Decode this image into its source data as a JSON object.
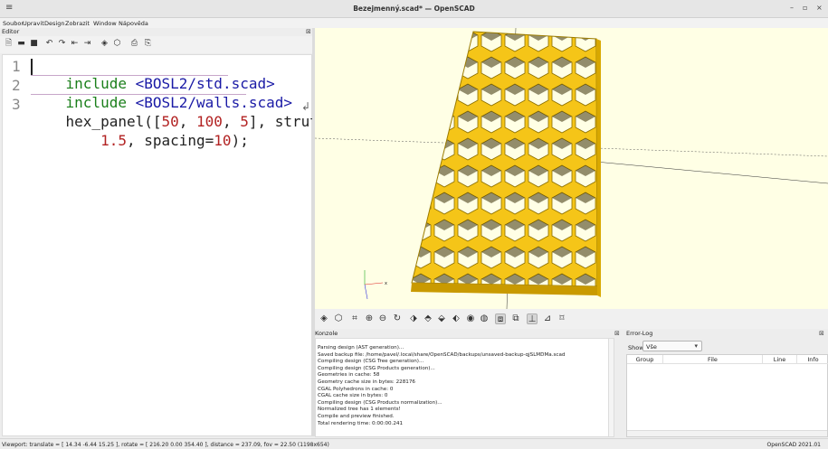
{
  "window": {
    "title": "Bezejmenný.scad* — OpenSCAD",
    "menu_icon": "≡",
    "minimize": "–",
    "maximize": "▫",
    "close": "×"
  },
  "menubar": [
    "Soubor",
    "Upravit",
    "Design",
    "Zobrazit",
    "Window",
    "Nápověda"
  ],
  "editor": {
    "title": "Editor",
    "lines": [
      {
        "n": "1",
        "tokens": [
          {
            "t": "include",
            "c": "kw"
          },
          {
            "t": " ",
            "c": "plain"
          },
          {
            "t": "<BOSL2/std.scad>",
            "c": "path"
          }
        ]
      },
      {
        "n": "2",
        "tokens": [
          {
            "t": "include",
            "c": "kw"
          },
          {
            "t": " ",
            "c": "plain"
          },
          {
            "t": "<BOSL2/walls.scad>",
            "c": "path"
          }
        ]
      },
      {
        "n": "3",
        "tokens": [
          {
            "t": "hex_panel([",
            "c": "plain"
          },
          {
            "t": "50",
            "c": "num"
          },
          {
            "t": ", ",
            "c": "plain"
          },
          {
            "t": "100",
            "c": "num"
          },
          {
            "t": ", ",
            "c": "plain"
          },
          {
            "t": "5",
            "c": "num"
          },
          {
            "t": "], strut=",
            "c": "plain"
          }
        ]
      },
      {
        "n": "",
        "tokens": [
          {
            "t": "    ",
            "c": "plain"
          },
          {
            "t": "1.5",
            "c": "num"
          },
          {
            "t": ", spacing=",
            "c": "plain"
          },
          {
            "t": "10",
            "c": "num"
          },
          {
            "t": ");",
            "c": "plain"
          }
        ]
      }
    ]
  },
  "viewport": {
    "bg": "#ffffe5",
    "model_color": "#f5c518",
    "axis_label": "x"
  },
  "konzole": {
    "title": "Konzole",
    "lines": [
      "Parsing design (AST generation)...",
      "Saved backup file: /home/pavel/.local/share/OpenSCAD/backups/unsaved-backup-qjSLMDMa.scad",
      "Compiling design (CSG Tree generation)...",
      "Compiling design (CSG Products generation)...",
      "Geometries in cache: 58",
      "Geometry cache size in bytes: 228176",
      "CGAL Polyhedrons in cache: 0",
      "CGAL cache size in bytes: 0",
      "Compiling design (CSG Products normalization)...",
      "Normalized tree has 1 elements!",
      "Compile and preview finished.",
      "Total rendering time: 0:00:00.241"
    ]
  },
  "error_log": {
    "title": "Error-Log",
    "show_label": "Show",
    "show_value": "Vše",
    "columns": [
      "Group",
      "File",
      "Line",
      "Info"
    ]
  },
  "status": {
    "viewport": "Viewport: translate = [ 14.34 -6.44 15.25 ], rotate = [ 216.20 0.00 354.40 ], distance = 237.09, fov = 22.50 (1198x654)",
    "version": "OpenSCAD 2021.01"
  }
}
